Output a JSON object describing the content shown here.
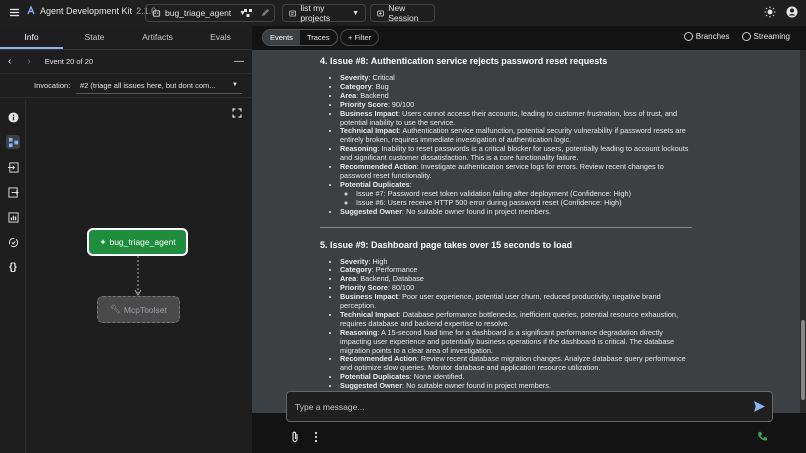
{
  "app": {
    "title": "Agent Development Kit",
    "version": "2.1.0"
  },
  "topbar": {
    "agent_name": "bug_triage_agent",
    "session_label": "list my projects",
    "new_session": "New Session"
  },
  "left": {
    "tabs": [
      "Info",
      "State",
      "Artifacts",
      "Evals"
    ],
    "event_label": "Event 20 of 20",
    "invocation_label": "Invocation:",
    "invocation_value": "#2 (triage all issues here, but dont com...",
    "graph": {
      "node_agent": "bug_triage_agent",
      "node_tool": "McpToolset"
    }
  },
  "main": {
    "tabs": [
      "Events",
      "Traces"
    ],
    "filter": "+ Filter",
    "branches": "Branches",
    "streaming": "Streaming",
    "placeholder": "Type a message..."
  },
  "issues": [
    {
      "title": "4. Issue #8: Authentication service rejects password reset requests",
      "fields": [
        [
          "Severity",
          ": Critical"
        ],
        [
          "Category",
          ": Bug"
        ],
        [
          "Area",
          ": Backend"
        ],
        [
          "Priority Score",
          ": 90/100"
        ],
        [
          "Business Impact",
          ": Users cannot access their accounts, leading to customer frustration, loss of trust, and potential inability to use the service."
        ],
        [
          "Technical Impact",
          ": Authentication service malfunction, potential security vulnerability if password resets are entirely broken, requires immediate investigation of authentication logic."
        ],
        [
          "Reasoning",
          ": Inability to reset passwords is a critical blocker for users, potentially leading to account lockouts and significant customer dissatisfaction. This is a core functionality failure."
        ],
        [
          "Recommended Action",
          ": Investigate authentication service logs for errors. Review recent changes to password reset functionality."
        ],
        [
          "Potential Duplicates",
          ":"
        ]
      ],
      "duplicates": [
        "Issue #7: Password reset token validation failing after deployment (Confidence: High)",
        "Issue #6: Users receive HTTP 500 error during password reset (Confidence: High)"
      ],
      "owner": [
        "Suggested Owner",
        ": No suitable owner found in project members."
      ]
    },
    {
      "title": "5. Issue #9: Dashboard page takes over 15 seconds to load",
      "fields": [
        [
          "Severity",
          ": High"
        ],
        [
          "Category",
          ": Performance"
        ],
        [
          "Area",
          ": Backend, Database"
        ],
        [
          "Priority Score",
          ": 80/100"
        ],
        [
          "Business Impact",
          ": Poor user experience, potential user churn, reduced productivity, negative brand perception."
        ],
        [
          "Technical Impact",
          ": Database performance bottlenecks, inefficient queries, potential resource exhaustion, requires database and backend expertise to resolve."
        ],
        [
          "Reasoning",
          ": A 15-second load time for a dashboard is a significant performance degradation directly impacting user experience and potentially business operations if the dashboard is critical. The database migration points to a clear area of investigation."
        ],
        [
          "Recommended Action",
          ": Review recent database migration changes. Analyze database query performance and optimize slow queries. Monitor database and application resource utilization."
        ],
        [
          "Potential Duplicates",
          ": None identified."
        ],
        [
          "Suggested Owner",
          ": No suitable owner found in project members."
        ]
      ]
    }
  ]
}
